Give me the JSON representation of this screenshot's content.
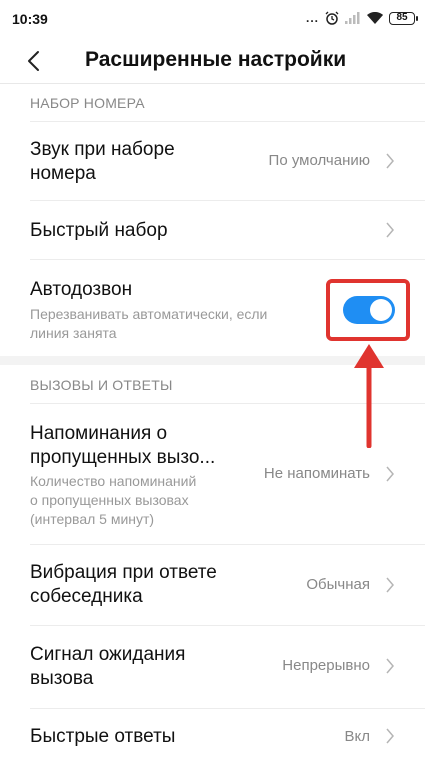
{
  "status": {
    "time": "10:39",
    "dots": "...",
    "battery": "85"
  },
  "header": {
    "title": "Расширенные настройки"
  },
  "sections": {
    "dial": {
      "title": "НАБОР НОМЕРА"
    },
    "calls": {
      "title": "ВЫЗОВЫ И ОТВЕТЫ"
    }
  },
  "rows": {
    "dial_sound": {
      "title_line1": "Звук при наборе",
      "title_line2": "номера",
      "value": "По умолчанию"
    },
    "quick_dial": {
      "title": "Быстрый набор"
    },
    "auto_redial": {
      "title": "Автодозвон",
      "sub_line1": "Перезванивать автоматически, если",
      "sub_line2": "линия занята",
      "enabled": true
    },
    "missed_reminders": {
      "title_line1": "Напоминания о",
      "title_line2": "пропущенных вызо...",
      "sub_line1": "Количество напоминаний",
      "sub_line2": "о пропущенных вызовах",
      "sub_line3": "(интервал 5 минут)",
      "value": "Не напоминать"
    },
    "vibration": {
      "title_line1": "Вибрация при ответе",
      "title_line2": "собеседника",
      "value": "Обычная"
    },
    "call_waiting": {
      "title_line1": "Сигнал ожидания",
      "title_line2": "вызова",
      "value": "Непрерывно"
    },
    "quick_replies": {
      "title": "Быстрые ответы",
      "value": "Вкл"
    }
  },
  "colors": {
    "accent": "#1f8ef3",
    "annotation": "#e0342f"
  },
  "icons": {
    "back": "chevron-left-icon",
    "chevron": "chevron-right-icon",
    "clock": "alarm-icon",
    "signal": "signal-icon",
    "wifi": "wifi-icon"
  }
}
